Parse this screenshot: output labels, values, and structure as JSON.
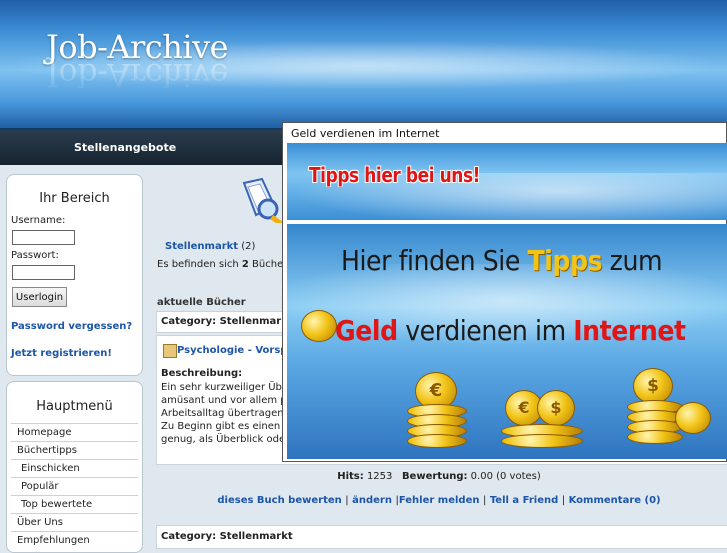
{
  "header": {
    "logo": "Job-Archive"
  },
  "navbar": {
    "item": "Stellenangebote"
  },
  "login": {
    "title": "Ihr Bereich",
    "username_label": "Username:",
    "password_label": "Passwort:",
    "button": "Userlogin",
    "forgot": "Password vergessen?",
    "register": "Jetzt registrieren!"
  },
  "menu": {
    "title": "Hauptmenü",
    "items": [
      "Homepage",
      "Büchertipps",
      "Einschicken",
      "Populär",
      "Top bewertete",
      "Über Uns",
      "Empfehlungen"
    ]
  },
  "main": {
    "category_link": "Stellenmarkt",
    "category_count": "(2)",
    "info_prefix": "Es befinden sich",
    "info_count": "2",
    "info_suffix": "Bücher in",
    "section_title": "aktuelle Bücher",
    "category_label": "Category: Stellenmarkt",
    "book_title": "Psychologie - Vorsprun",
    "desc_label": "Beschreibung:",
    "desc_lines": [
      "Ein sehr kurzweiliger Überl",
      "amüsant und vor allem pra",
      "Arbeitsalltag übertragen las",
      "Zu Beginn gibt es einen kur",
      "genug, als Überblick oder A"
    ],
    "hits_label": "Hits:",
    "hits_value": "1253",
    "rating_label": "Bewertung:",
    "rating_value": "0.00 (0 votes)",
    "actions": [
      "dieses Buch bewerten",
      "ändern",
      "Fehler melden",
      "Tell a Friend",
      "Kommentare (0)"
    ],
    "category_label_2": "Category: Stellenmarkt"
  },
  "popup": {
    "title": "Geld verdienen im Internet",
    "banner": "Tipps hier bei uns!",
    "ad_line1_a": "Hier finden Sie ",
    "ad_line1_b": "Tipps",
    "ad_line1_c": " zum",
    "ad_line2_a": "Geld",
    "ad_line2_b": " verdienen im ",
    "ad_line2_c": "Internet",
    "coin_symbols": [
      "€",
      "$",
      "€",
      "$"
    ]
  }
}
